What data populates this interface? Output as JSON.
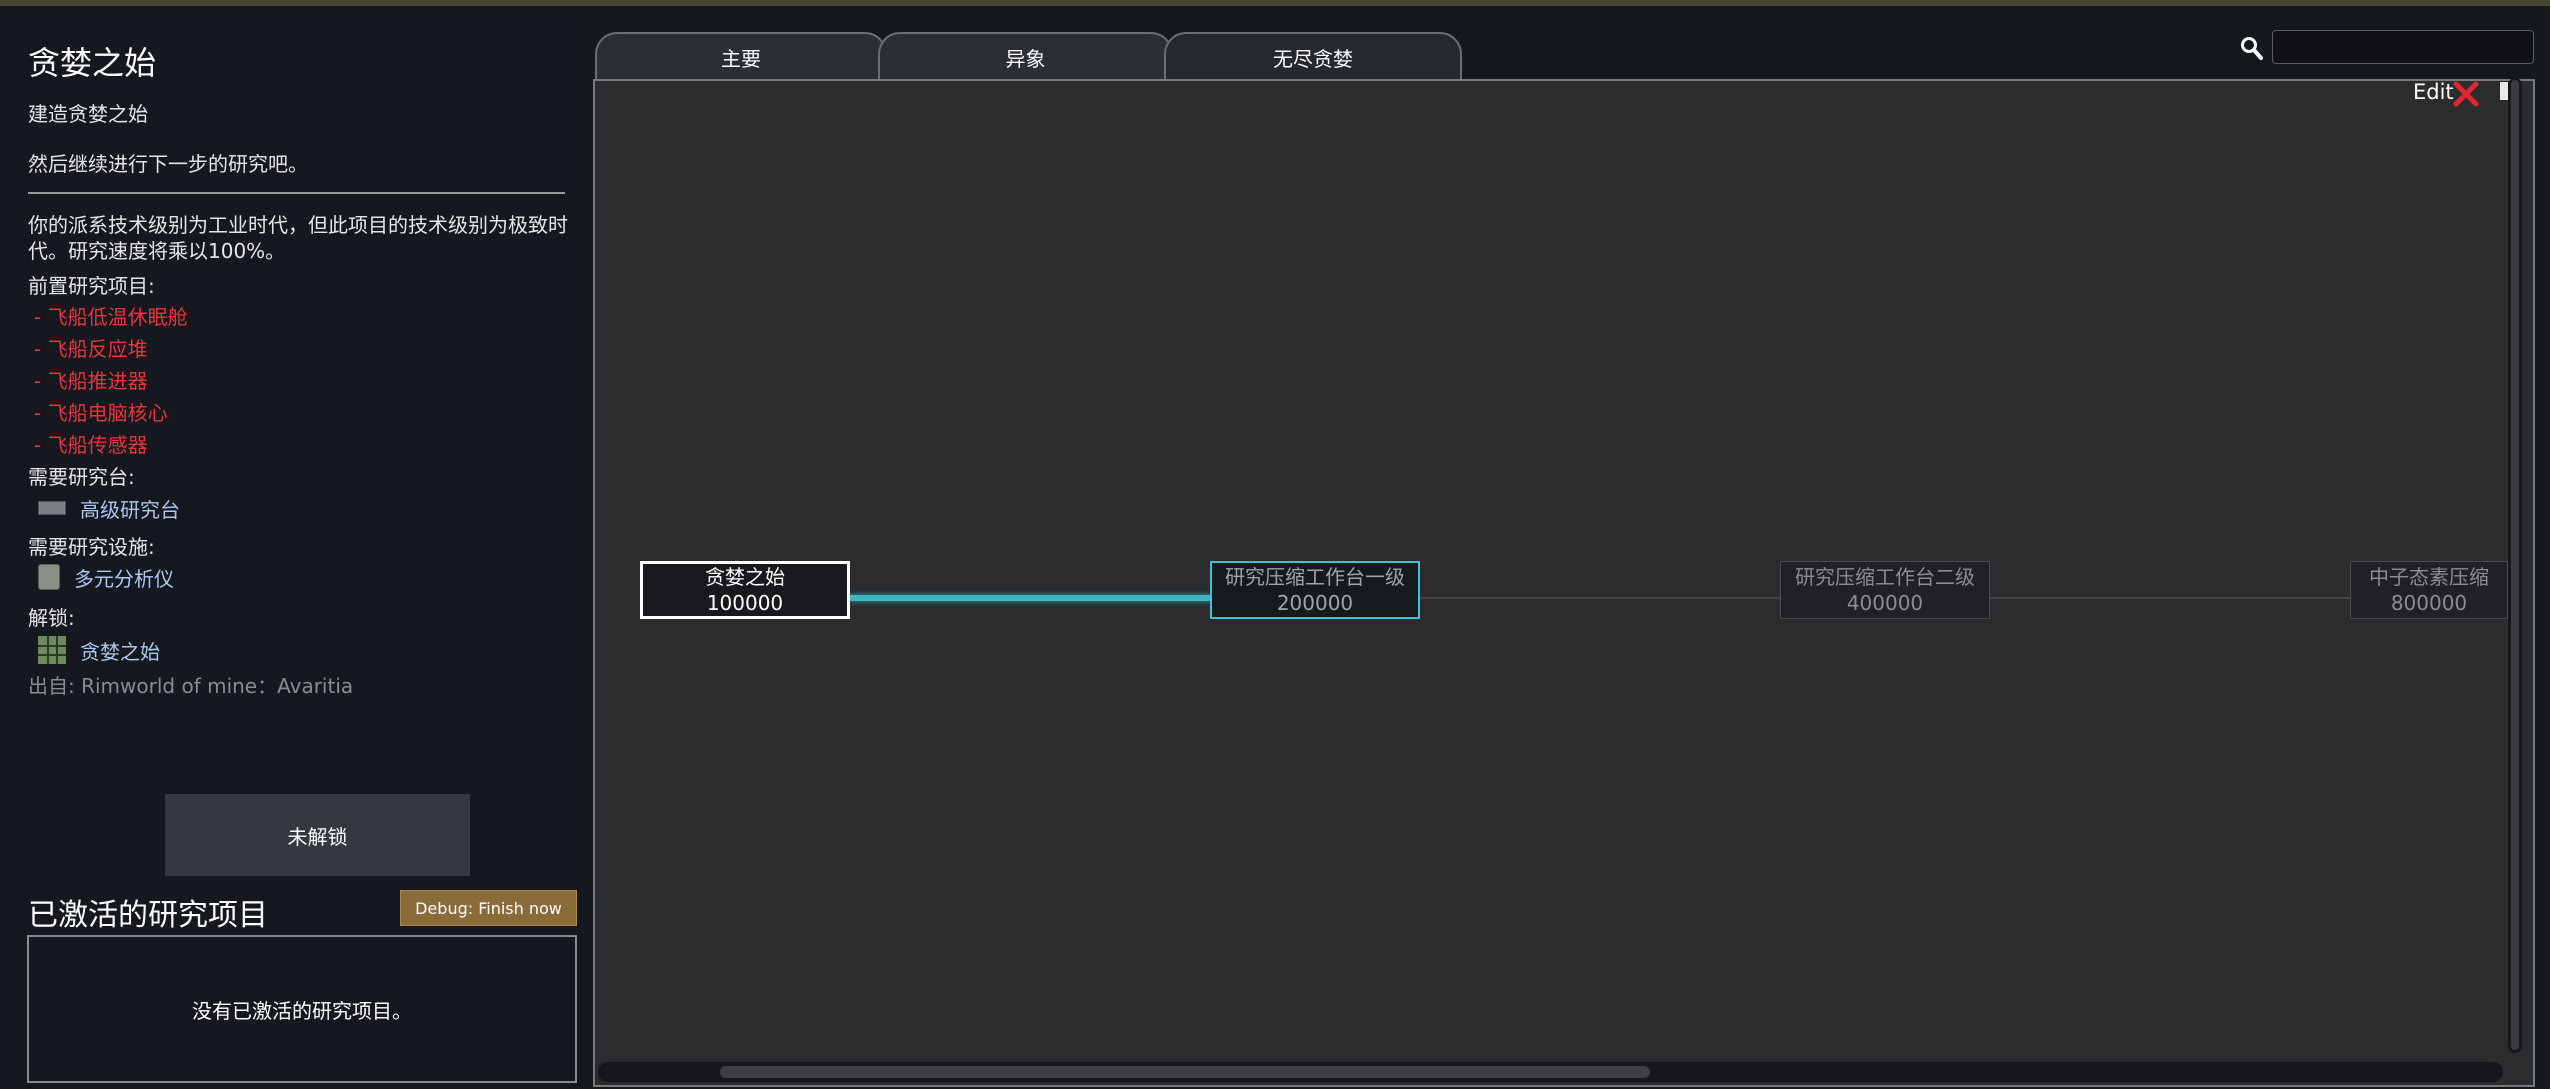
{
  "left_panel": {
    "title": "贪婪之始",
    "desc_line1": "建造贪婪之始",
    "desc_line2": "然后继续进行下一步的研究吧。",
    "tech_level_note": "你的派系技术级别为工业时代，但此项目的技术级别为极致时代。研究速度将乘以100%。",
    "prereq_header": "前置研究项目:",
    "prereqs": [
      "- 飞船低温休眠舱",
      "- 飞船反应堆",
      "- 飞船推进器",
      "- 飞船电脑核心",
      "- 飞船传感器"
    ],
    "bench_header": "需要研究台:",
    "bench": "高级研究台",
    "facility_header": "需要研究设施:",
    "facility": "多元分析仪",
    "unlocks_header": "解锁:",
    "unlock": "贪婪之始",
    "source": "出自: Rimworld of mine：Avaritia",
    "unlock_button": "未解锁",
    "active_title": "已激活的研究项目",
    "debug_button": "Debug: Finish now",
    "no_active": "没有已激活的研究项目。"
  },
  "tabs": [
    {
      "label": "主要",
      "active": false
    },
    {
      "label": "异象",
      "active": false
    },
    {
      "label": "无尽贪婪",
      "active": true
    }
  ],
  "search": {
    "value": "",
    "placeholder": ""
  },
  "toolbar": {
    "edit_label": "Edit"
  },
  "research_nodes": [
    {
      "name": "贪婪之始",
      "cost": "100000",
      "state": "current"
    },
    {
      "name": "研究压缩工作台一级",
      "cost": "200000",
      "state": "available"
    },
    {
      "name": "研究压缩工作台二级",
      "cost": "400000",
      "state": "locked"
    },
    {
      "name": "中子态素压缩",
      "cost": "800000",
      "state": "locked"
    }
  ],
  "colors": {
    "prereq_red": "#e8343a",
    "link_blue": "#aac8f2",
    "accent_cyan": "#39c6d2",
    "debug_brown": "#8a6b3a"
  }
}
